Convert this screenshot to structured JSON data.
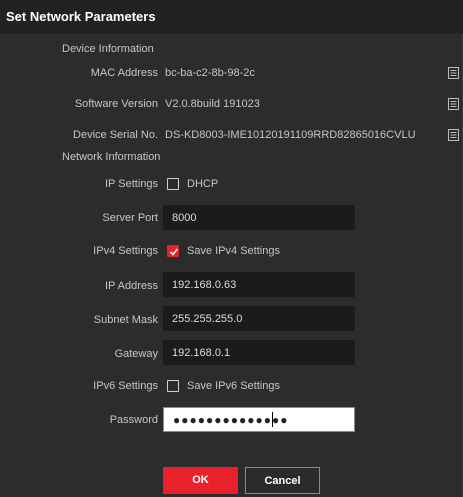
{
  "title": "Set Network Parameters",
  "device_info": {
    "section": "Device Information",
    "mac_label": "MAC Address",
    "mac_value": "bc-ba-c2-8b-98-2c",
    "software_label": "Software Version",
    "software_value": "V2.0.8build 191023",
    "serial_label": "Device Serial No.",
    "serial_value": "DS-KD8003-IME10120191109RRD82865016CVLU"
  },
  "network_info": {
    "section": "Network Information",
    "ip_settings_label": "IP Settings",
    "dhcp_label": "DHCP",
    "dhcp_checked": false,
    "server_port_label": "Server Port",
    "server_port_value": "8000",
    "ipv4_label": "IPv4 Settings",
    "save_ipv4_label": "Save IPv4 Settings",
    "save_ipv4_checked": true,
    "ip_address_label": "IP Address",
    "ip_address_value": "192.168.0.63",
    "subnet_label": "Subnet Mask",
    "subnet_value": "255.255.255.0",
    "gateway_label": "Gateway",
    "gateway_value": "192.168.0.1",
    "ipv6_label": "IPv6 Settings",
    "save_ipv6_label": "Save IPv6 Settings",
    "save_ipv6_checked": false,
    "password_label": "Password",
    "password_value": "●●●●●●●●●●●●●●"
  },
  "buttons": {
    "ok": "OK",
    "cancel": "Cancel"
  },
  "icons": {
    "copy": "copy-icon"
  },
  "colors": {
    "accent": "#e8212a",
    "background": "#2c2c2c",
    "field": "#1b1b1b"
  }
}
